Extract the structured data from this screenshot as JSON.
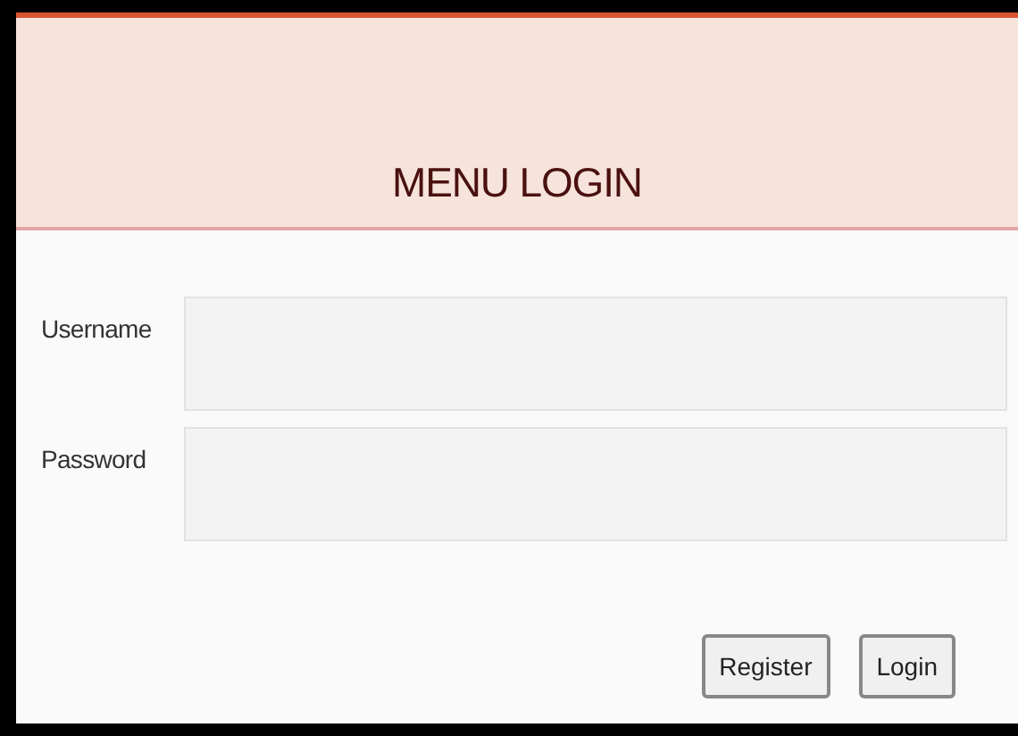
{
  "header": {
    "title": "MENU LOGIN"
  },
  "fields": [
    {
      "label": "Username"
    },
    {
      "label": "Password"
    }
  ],
  "buttons": [
    "Register",
    "Login"
  ]
}
